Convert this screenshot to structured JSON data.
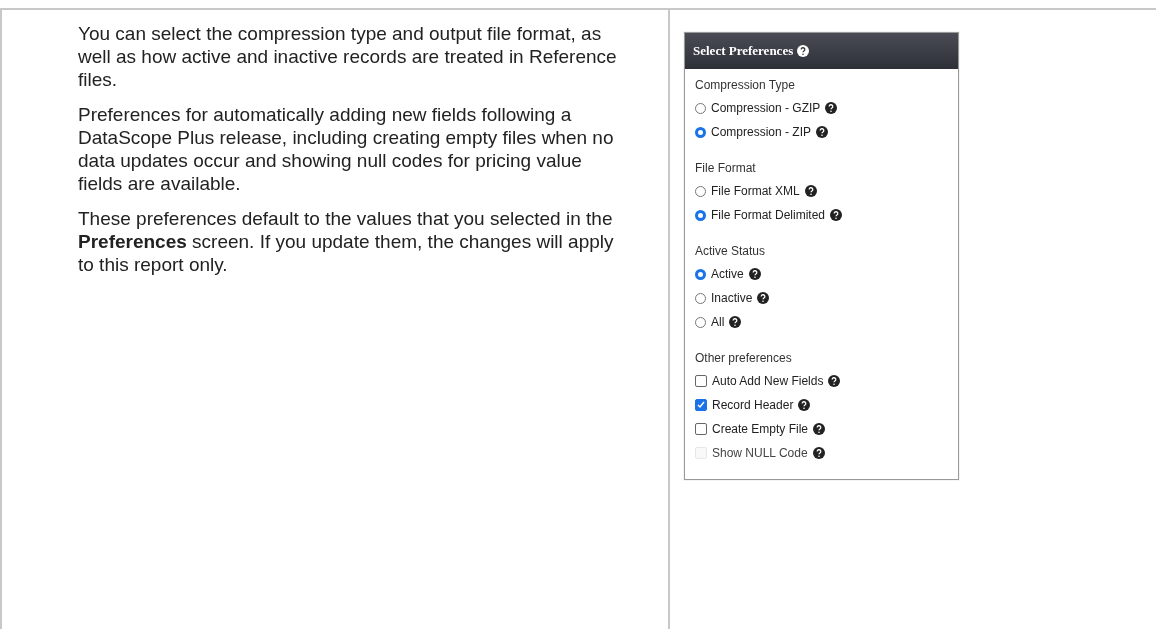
{
  "description": [
    "You can select the compression type and output file format, as well as how active and inactive records are treated in Reference files.",
    "Preferences for automatically adding new fields following a DataScope Plus release, including creating empty files when no data updates occur and showing null codes for pricing value fields are available.",
    "These preferences default to the values that you selected in the **Preferences** screen. If you update them, the changes will apply to this report only."
  ],
  "panel": {
    "title": "Select Preferences",
    "groups": [
      {
        "heading": "Compression Type",
        "kind": "radio",
        "options": [
          {
            "label": "Compression - GZIP",
            "selected": false
          },
          {
            "label": "Compression - ZIP",
            "selected": true
          }
        ]
      },
      {
        "heading": "File Format",
        "kind": "radio",
        "options": [
          {
            "label": "File Format XML",
            "selected": false
          },
          {
            "label": "File Format Delimited",
            "selected": true
          }
        ]
      },
      {
        "heading": "Active Status",
        "kind": "radio",
        "options": [
          {
            "label": "Active",
            "selected": true
          },
          {
            "label": "Inactive",
            "selected": false
          },
          {
            "label": "All",
            "selected": false
          }
        ]
      },
      {
        "heading": "Other preferences",
        "kind": "checkbox",
        "options": [
          {
            "label": "Auto Add New Fields",
            "checked": false,
            "disabled": false
          },
          {
            "label": "Record Header",
            "checked": true,
            "disabled": false
          },
          {
            "label": "Create Empty File",
            "checked": false,
            "disabled": false
          },
          {
            "label": "Show NULL Code",
            "checked": false,
            "disabled": true
          }
        ]
      }
    ]
  }
}
